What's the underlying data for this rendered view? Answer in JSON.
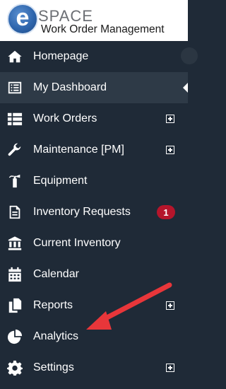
{
  "brand": {
    "logo_letter": "e",
    "logo_word": "SPACE",
    "subtitle": "Work Order Management"
  },
  "nav": {
    "items": [
      {
        "label": "Homepage",
        "icon": "home-icon"
      },
      {
        "label": "My Dashboard",
        "icon": "list-icon",
        "active": true
      },
      {
        "label": "Work Orders",
        "icon": "table-icon",
        "expandable": true
      },
      {
        "label": "Maintenance [PM]",
        "icon": "wrench-icon",
        "expandable": true
      },
      {
        "label": "Equipment",
        "icon": "fire-extinguisher-icon"
      },
      {
        "label": "Inventory Requests",
        "icon": "document-icon",
        "badge": "1"
      },
      {
        "label": "Current Inventory",
        "icon": "building-icon"
      },
      {
        "label": "Calendar",
        "icon": "calendar-icon"
      },
      {
        "label": "Reports",
        "icon": "copy-icon",
        "expandable": true
      },
      {
        "label": "Analytics",
        "icon": "pie-chart-icon"
      },
      {
        "label": "Settings",
        "icon": "gear-icon",
        "expandable": true
      }
    ]
  },
  "colors": {
    "sidebar_bg": "#1f2a37",
    "active_bg": "#2e3a47",
    "badge_bg": "#b5152b",
    "annotation_arrow": "#e8363a"
  }
}
